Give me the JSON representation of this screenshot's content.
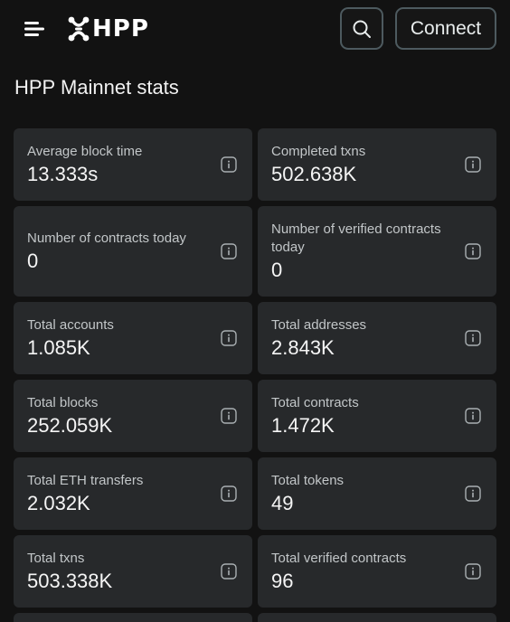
{
  "header": {
    "logo_text": "HPP",
    "connect_label": "Connect"
  },
  "page": {
    "title": "HPP Mainnet stats"
  },
  "stats": [
    {
      "label": "Average block time",
      "value": "13.333s"
    },
    {
      "label": "Completed txns",
      "value": "502.638K"
    },
    {
      "label": "Number of contracts today",
      "value": "0"
    },
    {
      "label": "Number of verified contracts today",
      "value": "0"
    },
    {
      "label": "Total accounts",
      "value": "1.085K"
    },
    {
      "label": "Total addresses",
      "value": "2.843K"
    },
    {
      "label": "Total blocks",
      "value": "252.059K"
    },
    {
      "label": "Total contracts",
      "value": "1.472K"
    },
    {
      "label": "Total ETH transfers",
      "value": "2.032K"
    },
    {
      "label": "Total tokens",
      "value": "49"
    },
    {
      "label": "Total txns",
      "value": "503.338K"
    },
    {
      "label": "Total verified contracts",
      "value": "96"
    }
  ],
  "colors": {
    "background": "#121212",
    "card": "#27292b",
    "button_border": "#4d5a5f"
  },
  "icons": {
    "menu": "hamburger-menu-icon",
    "search": "search-icon",
    "info": "info-icon",
    "logo": "hpp-logo-mark"
  }
}
